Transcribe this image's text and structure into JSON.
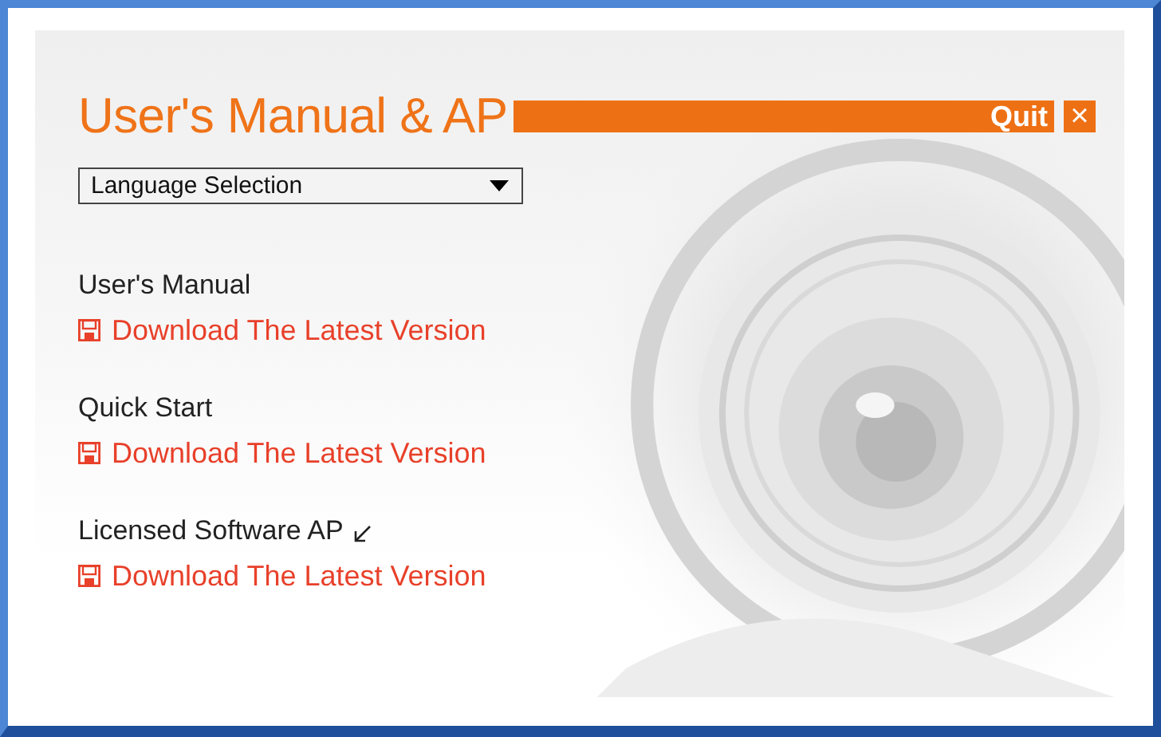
{
  "header": {
    "title": "User's Manual & AP",
    "quit_label": "Quit",
    "close_symbol": "×"
  },
  "language_dropdown": {
    "value": "Language Selection"
  },
  "sections": [
    {
      "heading": "User's Manual",
      "has_arrow": false,
      "link": "Download The Latest Version"
    },
    {
      "heading": "Quick Start",
      "has_arrow": false,
      "link": "Download The Latest Version"
    },
    {
      "heading": "Licensed Software AP",
      "has_arrow": true,
      "link": "Download The Latest Version"
    }
  ]
}
